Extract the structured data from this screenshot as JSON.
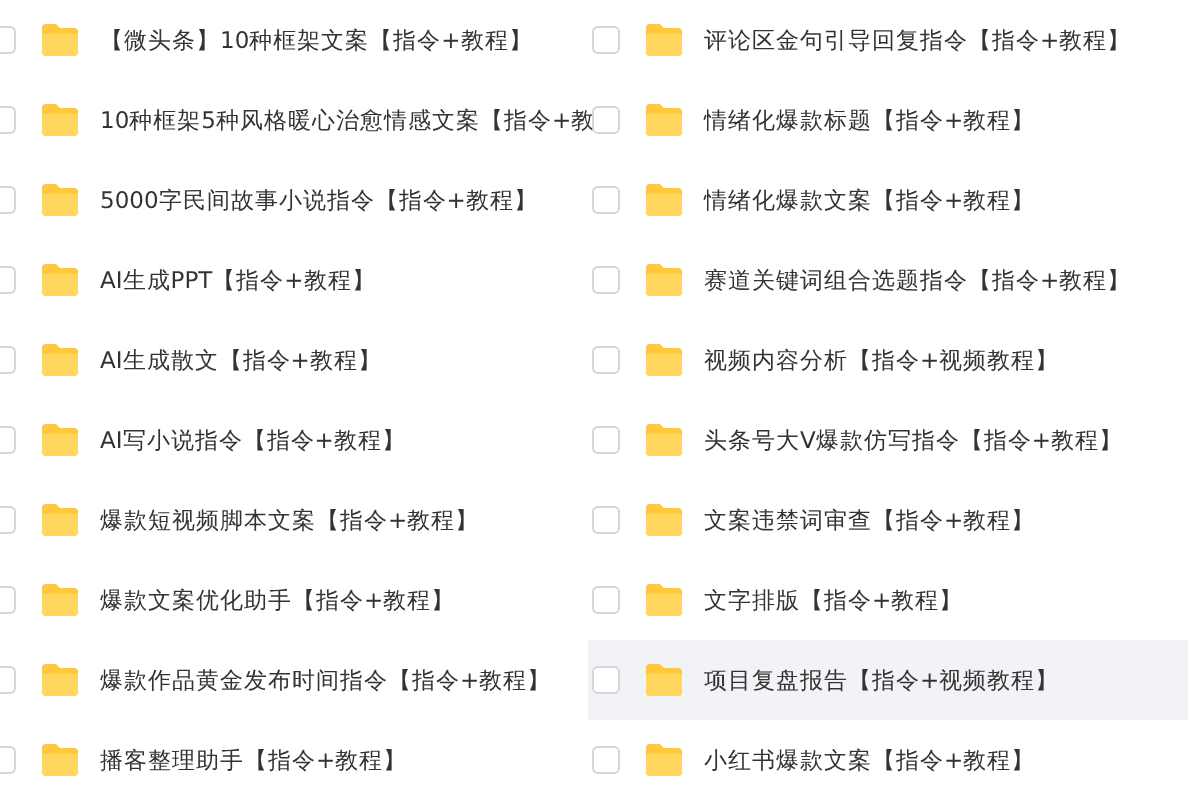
{
  "columns": [
    {
      "rows": [
        {
          "name": "【微头条】10种框架文案【指令+教程】",
          "checked": false,
          "hovered": false
        },
        {
          "name": "10种框架5种风格暖心治愈情感文案【指令+教",
          "checked": false,
          "hovered": false
        },
        {
          "name": "5000字民间故事小说指令【指令+教程】",
          "checked": false,
          "hovered": false
        },
        {
          "name": "AI生成PPT【指令+教程】",
          "checked": false,
          "hovered": false
        },
        {
          "name": "AI生成散文【指令+教程】",
          "checked": false,
          "hovered": false
        },
        {
          "name": "AI写小说指令【指令+教程】",
          "checked": false,
          "hovered": false
        },
        {
          "name": "爆款短视频脚本文案【指令+教程】",
          "checked": false,
          "hovered": false
        },
        {
          "name": "爆款文案优化助手【指令+教程】",
          "checked": false,
          "hovered": false
        },
        {
          "name": "爆款作品黄金发布时间指令【指令+教程】",
          "checked": false,
          "hovered": false
        },
        {
          "name": "播客整理助手【指令+教程】",
          "checked": false,
          "hovered": false
        }
      ]
    },
    {
      "rows": [
        {
          "name": "评论区金句引导回复指令【指令+教程】",
          "checked": false,
          "hovered": false
        },
        {
          "name": "情绪化爆款标题【指令+教程】",
          "checked": false,
          "hovered": false
        },
        {
          "name": "情绪化爆款文案【指令+教程】",
          "checked": false,
          "hovered": false
        },
        {
          "name": "赛道关键词组合选题指令【指令+教程】",
          "checked": false,
          "hovered": false
        },
        {
          "name": "视频内容分析【指令+视频教程】",
          "checked": false,
          "hovered": false
        },
        {
          "name": "头条号大V爆款仿写指令【指令+教程】",
          "checked": false,
          "hovered": false
        },
        {
          "name": "文案违禁词审查【指令+教程】",
          "checked": false,
          "hovered": false
        },
        {
          "name": "文字排版【指令+教程】",
          "checked": false,
          "hovered": false
        },
        {
          "name": "项目复盘报告【指令+视频教程】",
          "checked": false,
          "hovered": true
        },
        {
          "name": "小红书爆款文案【指令+教程】",
          "checked": false,
          "hovered": false
        }
      ]
    }
  ]
}
